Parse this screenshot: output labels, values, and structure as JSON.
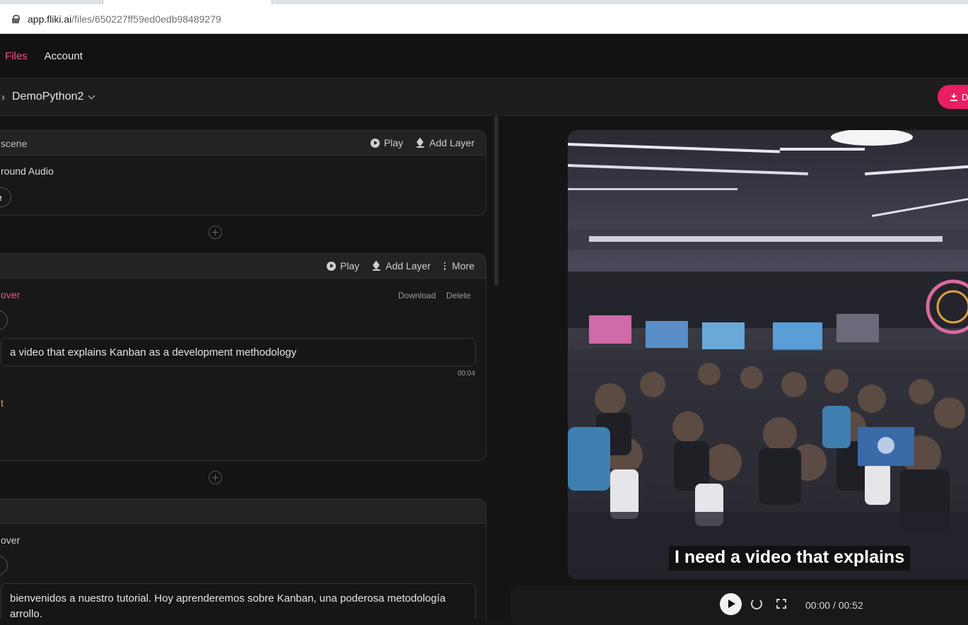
{
  "browser": {
    "url_host": "app.fliki.ai",
    "url_path": "/files/650227ff59ed0edb98489279"
  },
  "nav": {
    "files": "Files",
    "account": "Account"
  },
  "project": {
    "title": "DemoPython2",
    "download_label": "D"
  },
  "scene_global": {
    "header_label": "scene",
    "play": "Play",
    "add_layer": "Add Layer",
    "audio_label": "round Audio",
    "file_button": "file"
  },
  "scene1": {
    "play": "Play",
    "add_layer": "Add Layer",
    "more": "More",
    "voiceover_label": "over",
    "download": "Download",
    "delete": "Delete",
    "text": "a video that explains Kanban as a development methodology",
    "duration": "00:04",
    "extra_label": "t"
  },
  "scene2": {
    "voiceover_label": "over",
    "text_line1": "bienvenidos a nuestro tutorial. Hoy aprenderemos sobre Kanban, una poderosa metodología",
    "text_line2": "arrollo."
  },
  "player": {
    "caption": "I need a video that explains",
    "time": "00:00 / 00:52"
  },
  "colors": {
    "accent": "#ee4f8b",
    "button": "#e91e63",
    "background": "#141414"
  }
}
